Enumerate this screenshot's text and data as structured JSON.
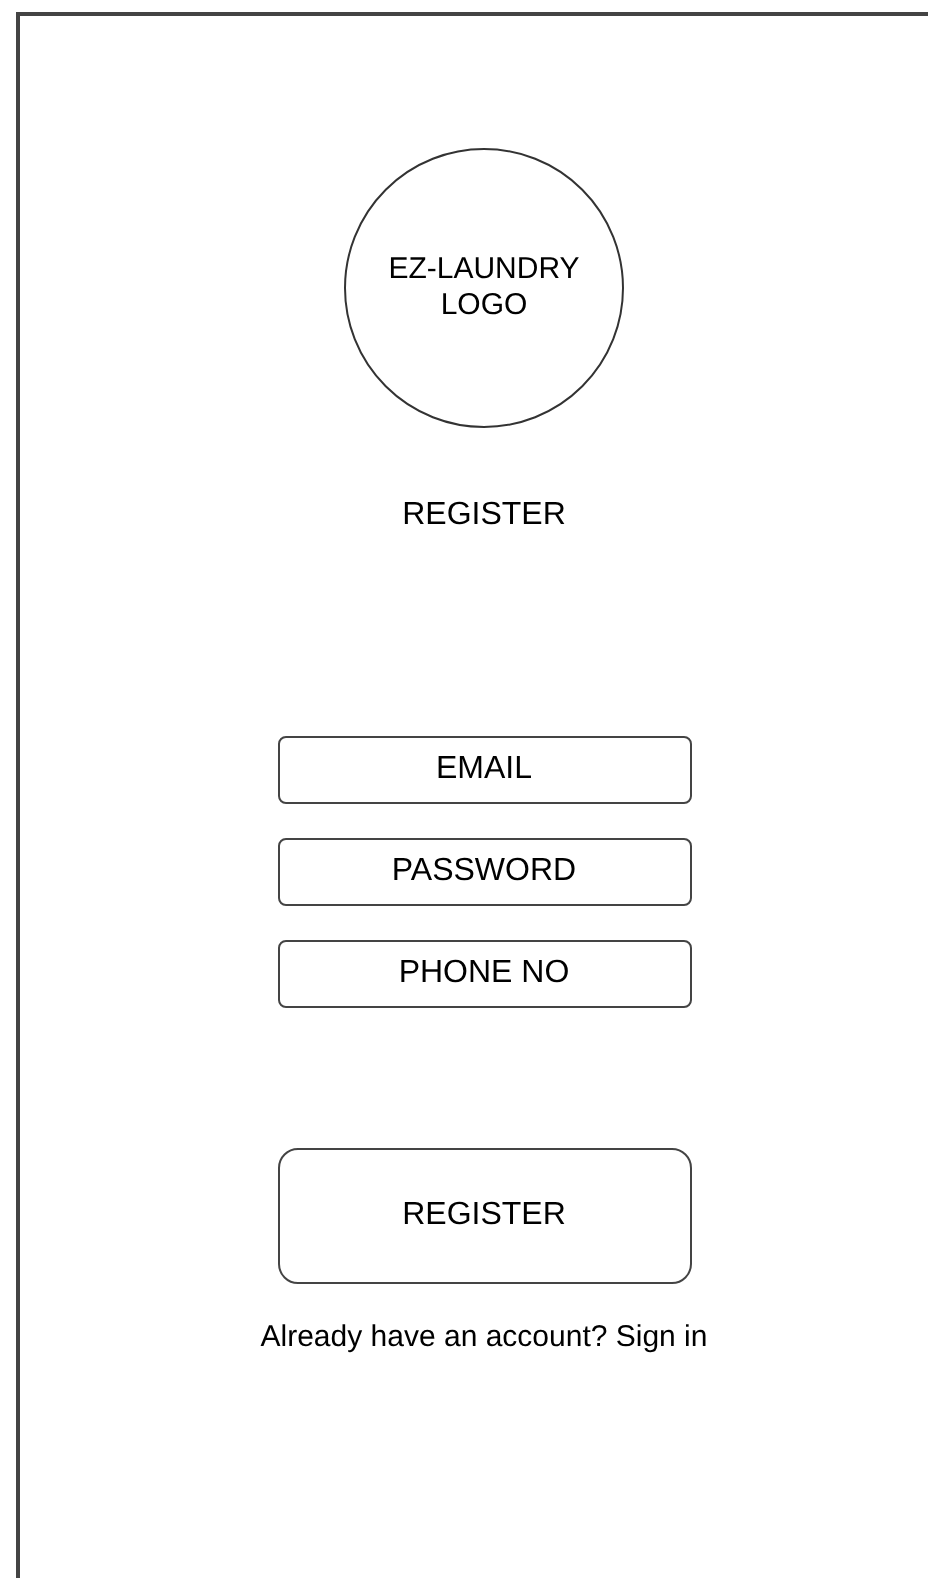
{
  "logo": {
    "text": "EZ-LAUNDRY LOGO"
  },
  "title": "REGISTER",
  "fields": [
    {
      "placeholder": "EMAIL"
    },
    {
      "placeholder": "PASSWORD"
    },
    {
      "placeholder": "PHONE NO"
    }
  ],
  "register_button": "REGISTER",
  "sign_in_prompt": "Already have an account? Sign in"
}
